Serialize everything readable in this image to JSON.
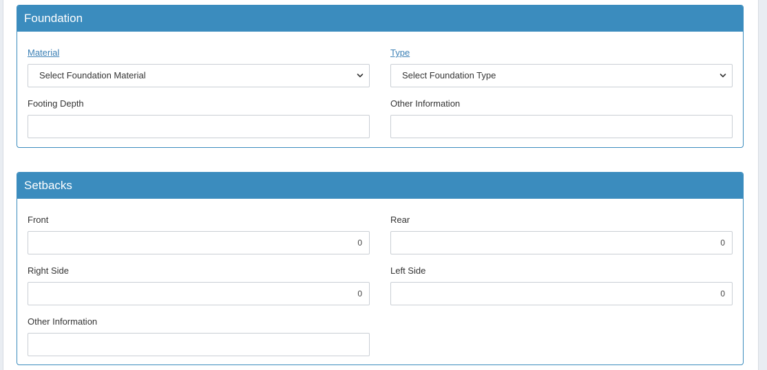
{
  "foundation": {
    "title": "Foundation",
    "material": {
      "label": "Material",
      "selected": "Select Foundation Material"
    },
    "type": {
      "label": "Type",
      "selected": "Select Foundation Type"
    },
    "footing_depth": {
      "label": "Footing Depth",
      "value": ""
    },
    "other_information": {
      "label": "Other Information",
      "value": ""
    }
  },
  "setbacks": {
    "title": "Setbacks",
    "front": {
      "label": "Front",
      "value": "0"
    },
    "rear": {
      "label": "Rear",
      "value": "0"
    },
    "right_side": {
      "label": "Right Side",
      "value": "0"
    },
    "left_side": {
      "label": "Left Side",
      "value": "0"
    },
    "other_information": {
      "label": "Other Information",
      "value": ""
    }
  },
  "icons": {
    "dropdown": "chevron-down-icon"
  },
  "colors": {
    "header_bg": "#3b8cbe",
    "panel_border": "#3a8bbd",
    "link": "#3a7fb5"
  }
}
